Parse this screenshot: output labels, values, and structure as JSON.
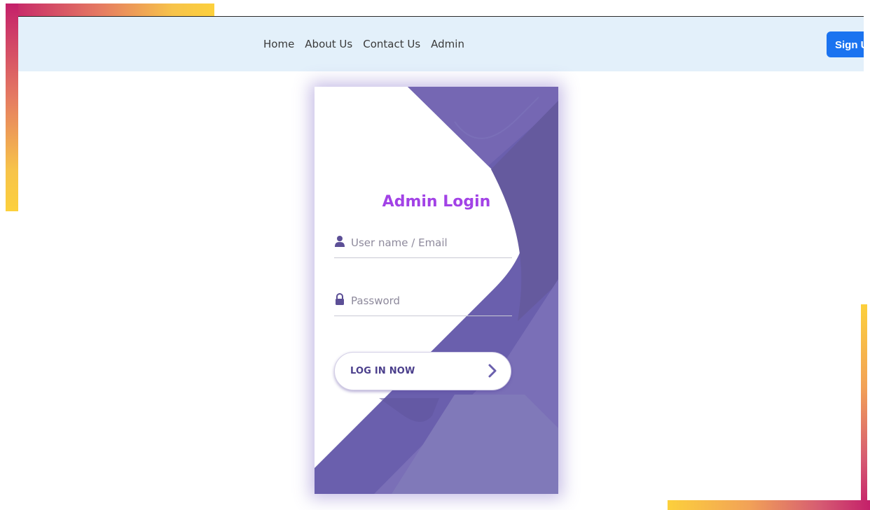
{
  "nav": {
    "links": [
      {
        "label": "Home"
      },
      {
        "label": "About Us"
      },
      {
        "label": "Contact Us"
      },
      {
        "label": "Admin"
      }
    ],
    "signup_label": "Sign Up"
  },
  "login": {
    "title": "Admin Login",
    "username_placeholder": "User name / Email",
    "password_placeholder": "Password",
    "submit_label": "LOG IN NOW",
    "icons": {
      "username": "user-icon",
      "password": "lock-icon",
      "submit": "chevron-right-icon"
    }
  },
  "colors": {
    "title": "#a242e6",
    "card_purple": "#6a5fad",
    "signup_button": "#1a73f0",
    "navbar_bg": "#e3f0fa"
  }
}
